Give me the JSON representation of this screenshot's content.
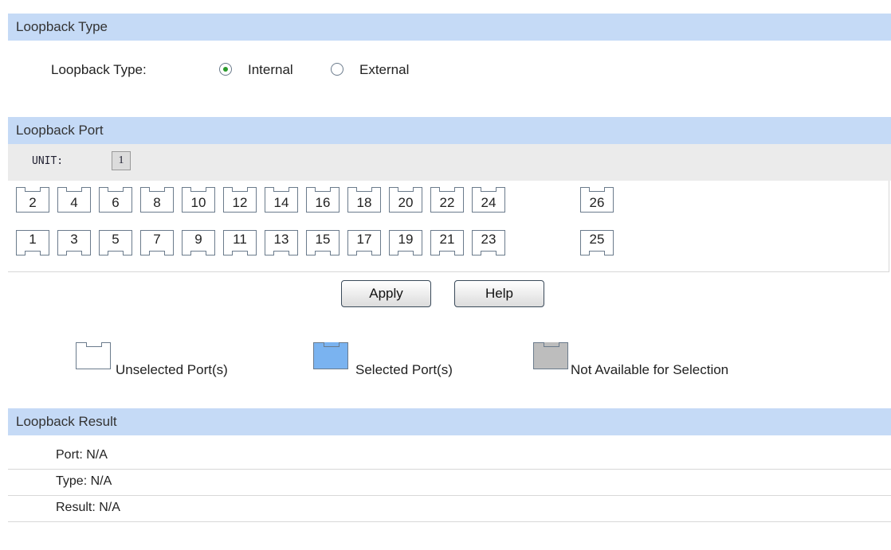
{
  "loopback_type_section": {
    "title": "Loopback Type",
    "label": "Loopback Type:",
    "options": [
      {
        "label": "Internal",
        "selected": true
      },
      {
        "label": "External",
        "selected": false
      }
    ]
  },
  "loopback_port_section": {
    "title": "Loopback Port",
    "unit_label": "UNIT:",
    "unit_value": "1",
    "top_ports": [
      "2",
      "4",
      "6",
      "8",
      "10",
      "12",
      "14",
      "16",
      "18",
      "20",
      "22",
      "24"
    ],
    "bottom_ports": [
      "1",
      "3",
      "5",
      "7",
      "9",
      "11",
      "13",
      "15",
      "17",
      "19",
      "21",
      "23"
    ],
    "extra_top_port": "26",
    "extra_bottom_port": "25"
  },
  "buttons": {
    "apply": "Apply",
    "help": "Help"
  },
  "legend": {
    "unselected": "Unselected Port(s)",
    "selected": "Selected Port(s)",
    "not_available": "Not Available for Selection",
    "colors": {
      "unselected": "#ffffff",
      "selected": "#7ab3f0",
      "not_available": "#bdbdbd"
    }
  },
  "loopback_result_section": {
    "title": "Loopback Result",
    "port": "Port:  N/A",
    "type": "Type:  N/A",
    "result": "Result:  N/A"
  }
}
